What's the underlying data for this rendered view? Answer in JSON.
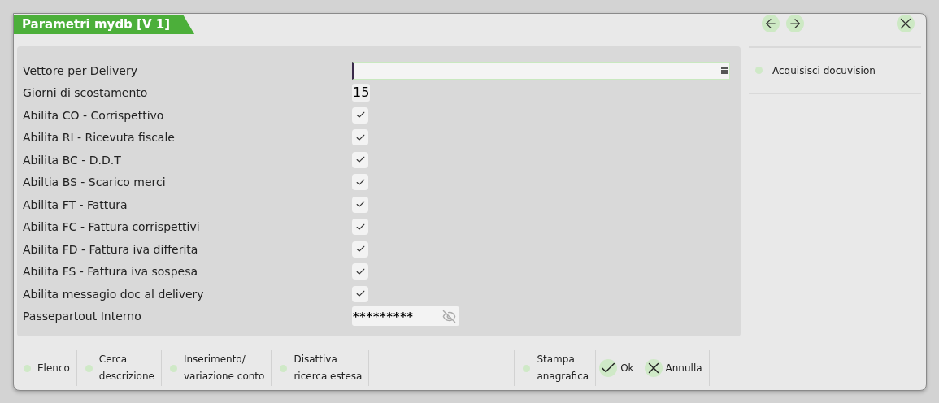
{
  "window": {
    "title": "Parametri mydb [V 1]"
  },
  "fields": [
    {
      "kind": "text",
      "label": "Vettore per Delivery"
    },
    {
      "kind": "number",
      "label": "Giorni di scostamento",
      "value": "15"
    },
    {
      "kind": "checkbox",
      "label": "Abilita CO - Corrispettivo",
      "checked": true
    },
    {
      "kind": "checkbox",
      "label": "Abilita RI - Ricevuta fiscale",
      "checked": true
    },
    {
      "kind": "checkbox",
      "label": "Abilita BC - D.D.T",
      "checked": true
    },
    {
      "kind": "checkbox",
      "label": "Abiltia BS - Scarico merci",
      "checked": true
    },
    {
      "kind": "checkbox",
      "label": "Abilita FT - Fattura",
      "checked": true
    },
    {
      "kind": "checkbox",
      "label": "Abilita FC - Fattura corrispettivi",
      "checked": true
    },
    {
      "kind": "checkbox",
      "label": "Abilita FD - Fattura iva differita",
      "checked": true
    },
    {
      "kind": "checkbox",
      "label": "Abilita FS - Fattura iva sospesa",
      "checked": true
    },
    {
      "kind": "checkbox",
      "label": "Abilita messagio doc al delivery",
      "checked": true
    },
    {
      "kind": "password",
      "label": "Passepartout Interno",
      "value": "*********"
    }
  ],
  "sidebar": {
    "items": [
      "Acquisisci docuvision"
    ]
  },
  "toolbar": {
    "left": [
      {
        "kind": "dot",
        "lines": [
          "Elenco"
        ]
      },
      {
        "kind": "dot",
        "lines": [
          "Cerca",
          "descrizione"
        ]
      },
      {
        "kind": "dot",
        "lines": [
          "Inserimento/",
          "variazione conto"
        ]
      },
      {
        "kind": "dot",
        "lines": [
          "Disattiva",
          "ricerca estesa"
        ]
      }
    ],
    "right": [
      {
        "kind": "dot",
        "lines": [
          "Stampa",
          "anagrafica"
        ]
      },
      {
        "kind": "ok",
        "lines": [
          "Ok"
        ]
      },
      {
        "kind": "cancel",
        "lines": [
          "Annulla"
        ]
      }
    ]
  }
}
